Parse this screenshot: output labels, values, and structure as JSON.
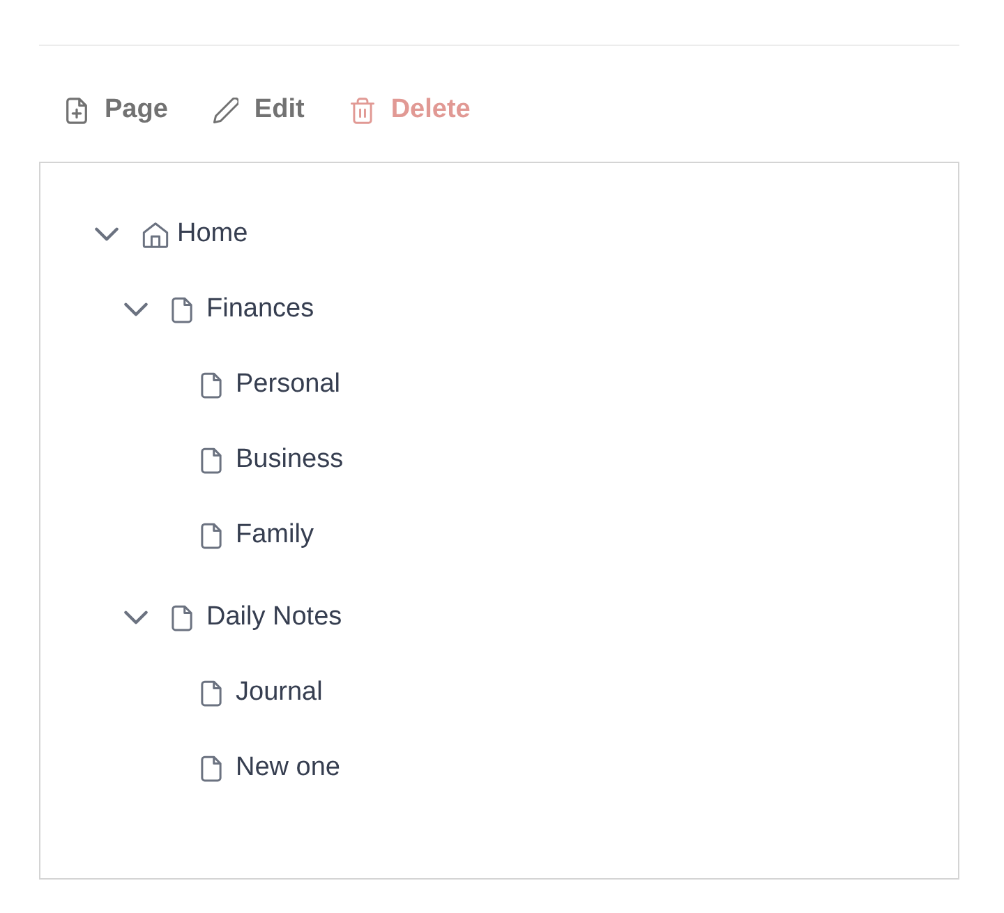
{
  "toolbar": [
    {
      "kind": "new-page",
      "label": "Page",
      "disabled": false
    },
    {
      "kind": "edit",
      "label": "Edit",
      "disabled": false
    },
    {
      "kind": "delete",
      "label": "Delete",
      "disabled": true
    }
  ],
  "tree": [
    {
      "kind": "home",
      "label": "Home",
      "expanded": true,
      "children": [
        {
          "kind": "page",
          "label": "Finances",
          "expanded": true,
          "children": [
            {
              "kind": "page",
              "label": "Personal"
            },
            {
              "kind": "page",
              "label": "Business"
            },
            {
              "kind": "page",
              "label": "Family"
            }
          ]
        },
        {
          "kind": "page",
          "label": "Daily Notes",
          "expanded": true,
          "children": [
            {
              "kind": "page",
              "label": "Journal"
            },
            {
              "kind": "page",
              "label": "New one"
            }
          ]
        }
      ]
    }
  ]
}
